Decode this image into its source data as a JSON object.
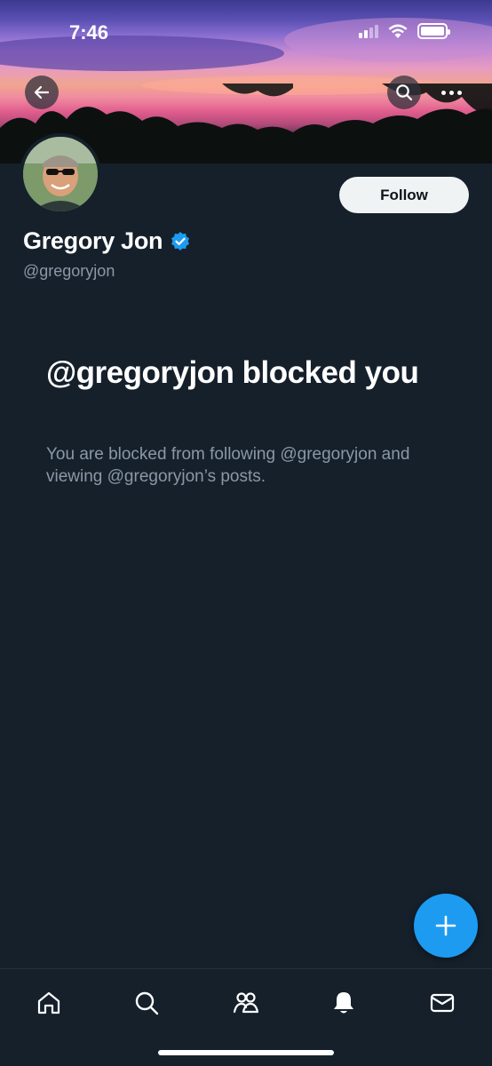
{
  "status_bar": {
    "time": "7:46"
  },
  "profile": {
    "display_name": "Gregory Jon",
    "handle": "@gregoryjon",
    "verified": true,
    "follow_label": "Follow"
  },
  "blocked": {
    "title": "@gregoryjon blocked you",
    "description": "You are blocked from following @gregoryjon and viewing @gregoryjon’s posts."
  },
  "nav": {
    "items": [
      "home-icon",
      "search-icon",
      "communities-icon",
      "notifications-icon",
      "messages-icon"
    ],
    "active": "notifications-icon"
  },
  "colors": {
    "background": "#15202b",
    "accent": "#1d9bf0",
    "secondary_text": "#8b98a5",
    "follow_button": "#eff3f4"
  }
}
